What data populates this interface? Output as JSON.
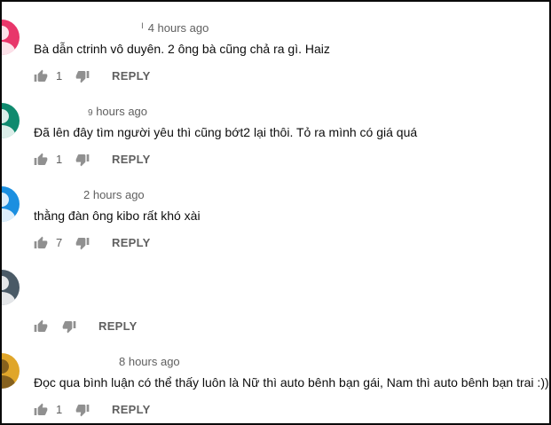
{
  "icons": {
    "like": "thumbs-up-icon",
    "dislike": "thumbs-down-icon"
  },
  "comments": [
    {
      "time": "4 hours ago",
      "text": "Bà dẫn ctrinh vô duyên. 2 ông bà cũng chả ra gì. Haiz",
      "likes": "1",
      "reply": "REPLY",
      "avatar_color": "#e8366a"
    },
    {
      "time": "hours ago",
      "time_prefix": "9",
      "text": "Đã lên đây tìm người yêu thì cũng bớt2 lại thôi. Tỏ ra mình có giá quá",
      "likes": "1",
      "reply": "REPLY",
      "avatar_color": "#0f8a6e"
    },
    {
      "time": "2 hours ago",
      "text": "thằng đàn ông kibo rất khó xài",
      "likes": "7",
      "reply": "REPLY",
      "avatar_color": "#1b8fe0"
    },
    {
      "time": "",
      "text": "",
      "likes": "",
      "reply": "REPLY",
      "avatar_color": "#4a5a66"
    },
    {
      "time": "8 hours ago",
      "text": "Đọc qua bình luận có thể thấy luôn là Nữ thì auto bênh bạn gái, Nam thì auto bênh bạn trai :)))",
      "likes": "1",
      "reply": "REPLY",
      "avatar_color": "#e0a62a"
    }
  ]
}
